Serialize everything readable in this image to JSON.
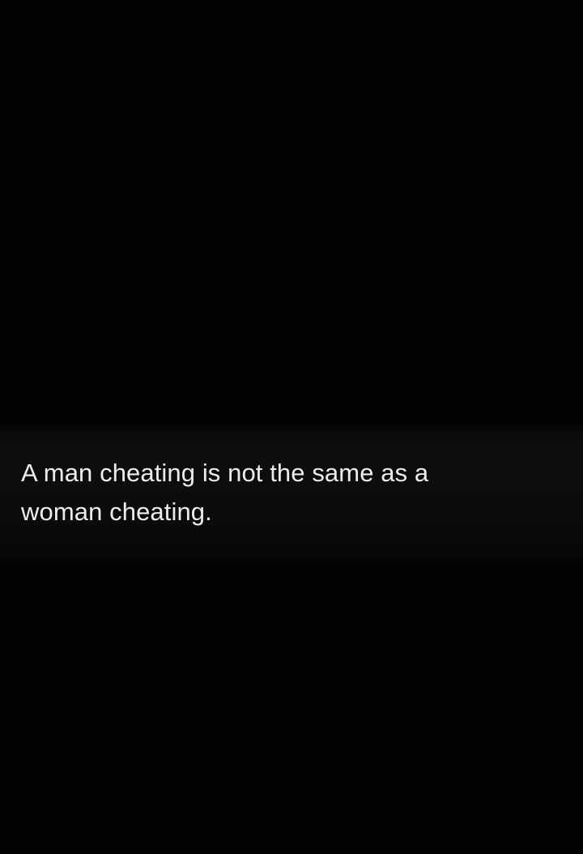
{
  "post": {
    "line1": "A man cheating is not the same as a",
    "line2": "woman cheating."
  },
  "colors": {
    "background": "#000000",
    "band": "#0e0e0e",
    "text": "#ececec"
  }
}
